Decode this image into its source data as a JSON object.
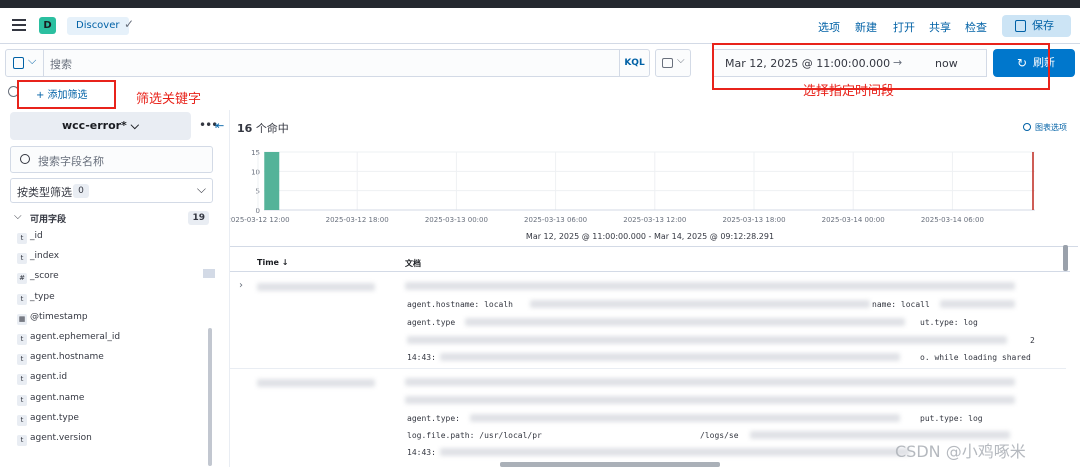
{
  "header": {
    "space_initial": "D",
    "app_breadcrumb": "Discover",
    "links": [
      "选项",
      "新建",
      "打开",
      "共享",
      "检查"
    ],
    "save_label": "保存"
  },
  "query_bar": {
    "search_placeholder": "搜索",
    "language_label": "KQL",
    "date_start": "Mar 12, 2025 @ 11:00:00.000",
    "date_arrow": "→",
    "date_end": "now",
    "refresh_label": "刷新"
  },
  "filters": {
    "add_filter_label": "+ 添加筛选"
  },
  "annotations": {
    "filter_note": "筛选关键字",
    "time_note": "选择指定时间段"
  },
  "sidebar": {
    "data_view": "wcc-error*",
    "field_search_placeholder": "搜索字段名称",
    "type_filter_label": "按类型筛选",
    "type_filter_count": "0",
    "available_label": "可用字段",
    "available_count": "19",
    "fields": [
      {
        "type": "t",
        "name": "_id"
      },
      {
        "type": "t",
        "name": "_index"
      },
      {
        "type": "#",
        "name": "_score"
      },
      {
        "type": "t",
        "name": "_type"
      },
      {
        "type": "date",
        "name": "@timestamp"
      },
      {
        "type": "t",
        "name": "agent.ephemeral_id"
      },
      {
        "type": "t",
        "name": "agent.hostname"
      },
      {
        "type": "t",
        "name": "agent.id"
      },
      {
        "type": "t",
        "name": "agent.name"
      },
      {
        "type": "t",
        "name": "agent.type"
      },
      {
        "type": "t",
        "name": "agent.version"
      }
    ]
  },
  "main": {
    "hits_count": "16",
    "hits_label": "个命中",
    "chart_options_label": "图表选项",
    "range_caption": "Mar 12, 2025 @ 11:00:00.000 - Mar 14, 2025 @ 09:12:28.291",
    "col_time": "Time ↓",
    "col_doc": "文档",
    "row1_lines": [
      "agent.hostname: localh",
      "name: locall",
      "agent.type",
      "ut.type: log",
      "2",
      "14:43:",
      "o. while loading shared"
    ],
    "row2_lines": [
      "agent.type:",
      "put.type: log",
      "log.file.path: /usr/local/pr",
      "/logs/se",
      "14:43:"
    ]
  },
  "watermark": "CSDN @小鸡啄米",
  "chart_data": {
    "type": "bar",
    "x": [
      "2025-03-12 12:00",
      "2025-03-12 18:00",
      "2025-03-13 00:00",
      "2025-03-13 06:00",
      "2025-03-13 12:00",
      "2025-03-13 18:00",
      "2025-03-14 00:00",
      "2025-03-14 06:00"
    ],
    "bars": [
      {
        "x": "2025-03-12 12:30",
        "value": 16
      }
    ],
    "ylim": [
      0,
      15
    ],
    "yticks": [
      0,
      5,
      10,
      15
    ],
    "bar_color": "#54b399",
    "now_marker_color": "#bd271e",
    "grid": true
  }
}
